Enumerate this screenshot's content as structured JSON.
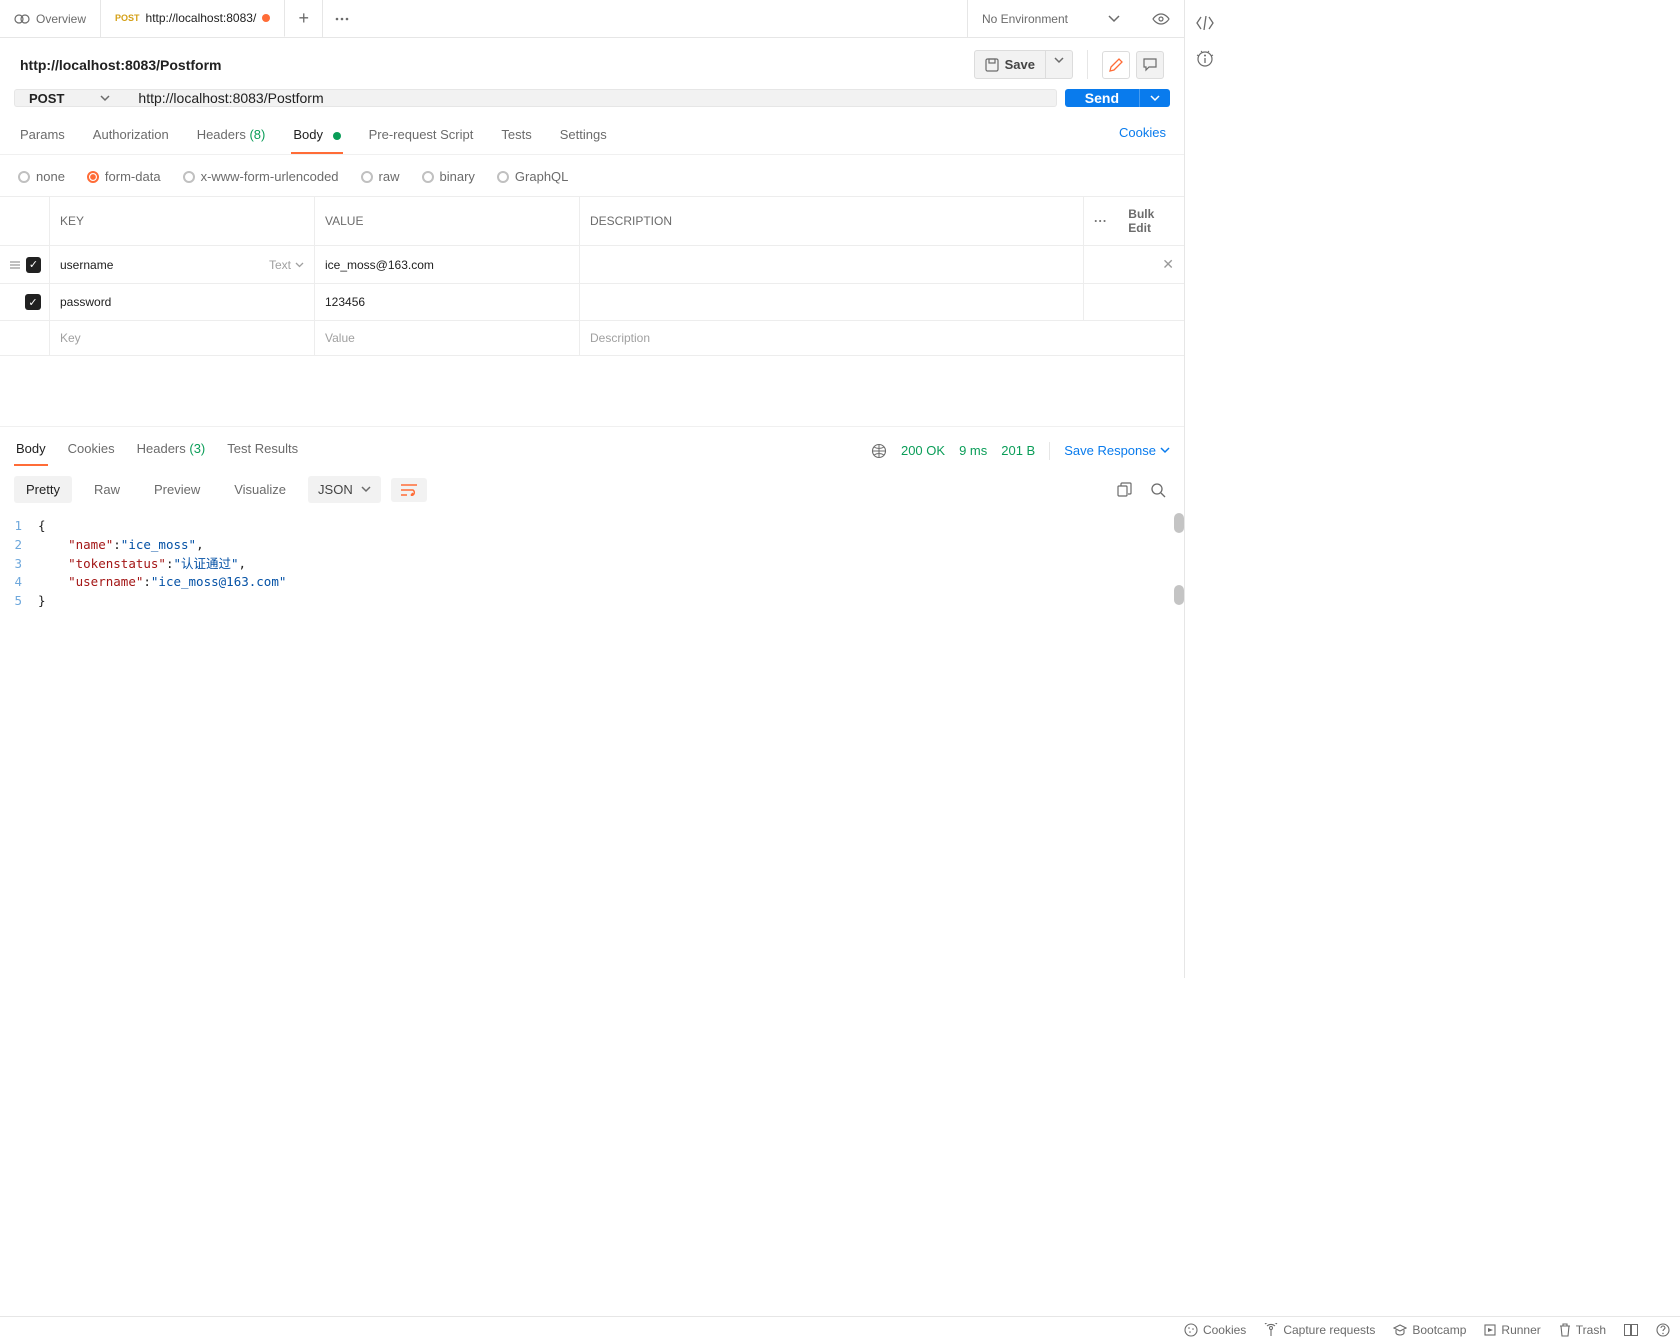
{
  "tabs": {
    "overview_label": "Overview",
    "request_method": "POST",
    "request_label": "http://localhost:8083/"
  },
  "environment": {
    "label": "No Environment"
  },
  "title": "http://localhost:8083/Postform",
  "save_label": "Save",
  "method": "POST",
  "url": "http://localhost:8083/Postform",
  "send_label": "Send",
  "req_tabs": {
    "params": "Params",
    "auth": "Authorization",
    "headers": "Headers",
    "headers_count": "(8)",
    "body": "Body",
    "prereq": "Pre-request Script",
    "tests": "Tests",
    "settings": "Settings",
    "cookies": "Cookies"
  },
  "body_types": {
    "none": "none",
    "formdata": "form-data",
    "urlencoded": "x-www-form-urlencoded",
    "raw": "raw",
    "binary": "binary",
    "graphql": "GraphQL"
  },
  "form_table": {
    "h_key": "KEY",
    "h_value": "VALUE",
    "h_desc": "DESCRIPTION",
    "bulk": "Bulk Edit",
    "rows": [
      {
        "key": "username",
        "type": "Text",
        "value": "ice_moss@163.com",
        "desc": ""
      },
      {
        "key": "password",
        "type": "",
        "value": "123456",
        "desc": ""
      }
    ],
    "ph_key": "Key",
    "ph_value": "Value",
    "ph_desc": "Description"
  },
  "resp_tabs": {
    "body": "Body",
    "cookies": "Cookies",
    "headers": "Headers",
    "headers_count": "(3)",
    "tests": "Test Results"
  },
  "resp_status": {
    "code": "200 OK",
    "time": "9 ms",
    "size": "201 B",
    "save": "Save Response"
  },
  "views": {
    "pretty": "Pretty",
    "raw": "Raw",
    "preview": "Preview",
    "visualize": "Visualize",
    "format": "JSON"
  },
  "json_lines": {
    "l1": "{",
    "l2k": "\"name\"",
    "l2v": "\"ice_moss\"",
    "l3k": "\"tokenstatus\"",
    "l3v": "\"认证通过\"",
    "l4k": "\"username\"",
    "l4v": "\"ice_moss@163.com\"",
    "l5": "}"
  },
  "footer": {
    "cookies": "Cookies",
    "capture": "Capture requests",
    "bootcamp": "Bootcamp",
    "runner": "Runner",
    "trash": "Trash"
  }
}
